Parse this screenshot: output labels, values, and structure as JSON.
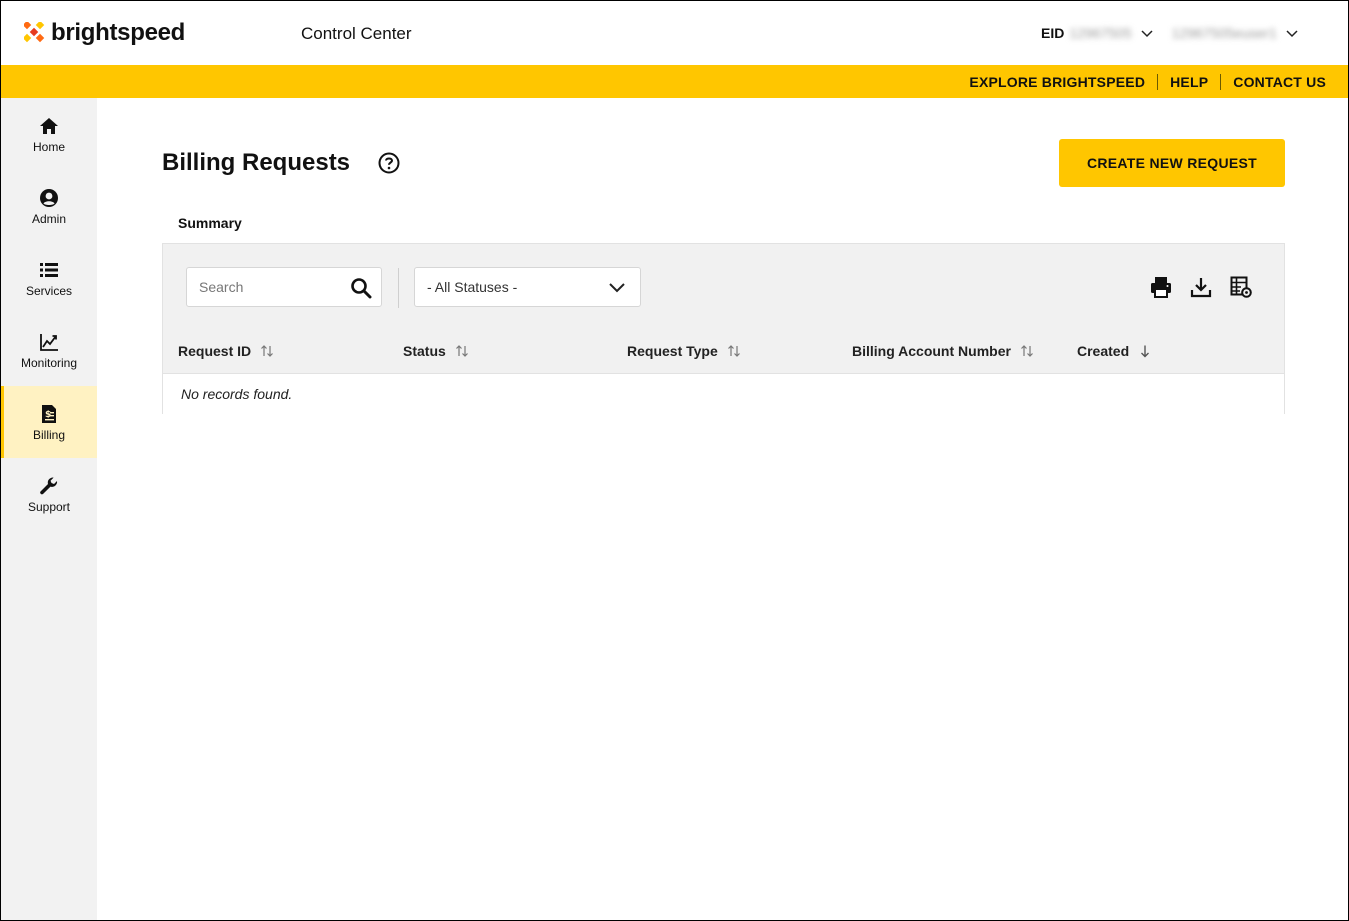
{
  "header": {
    "brand": "brightspeed",
    "app_title": "Control Center",
    "eid_label": "EID",
    "eid_value": "12967505",
    "user_value": "12967505euser1"
  },
  "topnav": {
    "items": [
      "EXPLORE BRIGHTSPEED",
      "HELP",
      "CONTACT US"
    ]
  },
  "sidebar": {
    "items": [
      {
        "label": "Home",
        "icon": "home-icon"
      },
      {
        "label": "Admin",
        "icon": "user-circle-icon"
      },
      {
        "label": "Services",
        "icon": "list-icon"
      },
      {
        "label": "Monitoring",
        "icon": "chart-line-icon"
      },
      {
        "label": "Billing",
        "icon": "billing-file-icon",
        "active": true
      },
      {
        "label": "Support",
        "icon": "wrench-icon"
      }
    ]
  },
  "main": {
    "title": "Billing Requests",
    "create_button": "CREATE NEW REQUEST",
    "tab": "Summary",
    "search_placeholder": "Search",
    "status_filter": "- All Statuses -",
    "columns": [
      "Request ID",
      "Status",
      "Request Type",
      "Billing Account Number",
      "Created"
    ],
    "empty_message": "No records found."
  },
  "colors": {
    "accent": "#ffc600",
    "sidebar_bg": "#f2f2f2",
    "active_bg": "#fff2c2"
  }
}
